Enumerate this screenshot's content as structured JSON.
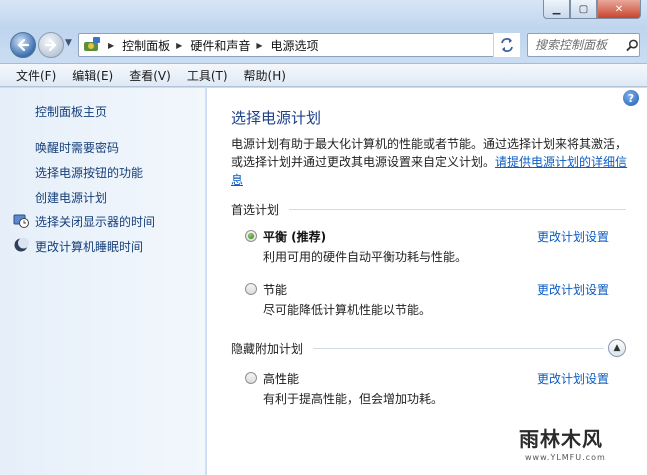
{
  "nav": {
    "breadcrumb": [
      "控制面板",
      "硬件和声音",
      "电源选项"
    ],
    "search_placeholder": "搜索控制面板"
  },
  "menu": [
    "文件(F)",
    "编辑(E)",
    "查看(V)",
    "工具(T)",
    "帮助(H)"
  ],
  "sidebar": {
    "home": "控制面板主页",
    "links": [
      {
        "label": "唤醒时需要密码",
        "icon": null
      },
      {
        "label": "选择电源按钮的功能",
        "icon": null
      },
      {
        "label": "创建电源计划",
        "icon": null
      },
      {
        "label": "选择关闭显示器的时间",
        "icon": "monitor-clock-icon"
      },
      {
        "label": "更改计算机睡眠时间",
        "icon": "moon-icon"
      }
    ]
  },
  "main": {
    "title": "选择电源计划",
    "description": "电源计划有助于最大化计算机的性能或者节能。通过选择计划来将其激活，或选择计划并通过更改其电源设置来自定义计划。",
    "description_link": "请提供电源计划的详细信息",
    "preferred_header": "首选计划",
    "hidden_header": "隐藏附加计划",
    "plans": [
      {
        "name": "平衡 (推荐)",
        "desc": "利用可用的硬件自动平衡功耗与性能。",
        "link": "更改计划设置",
        "selected": true
      },
      {
        "name": "节能",
        "desc": "尽可能降低计算机性能以节能。",
        "link": "更改计划设置",
        "selected": false
      },
      {
        "name": "高性能",
        "desc": "有利于提高性能，但会增加功耗。",
        "link": "更改计划设置",
        "selected": false
      }
    ]
  },
  "watermark": {
    "text": "雨林木风",
    "url": "www.YLMFU.com"
  }
}
